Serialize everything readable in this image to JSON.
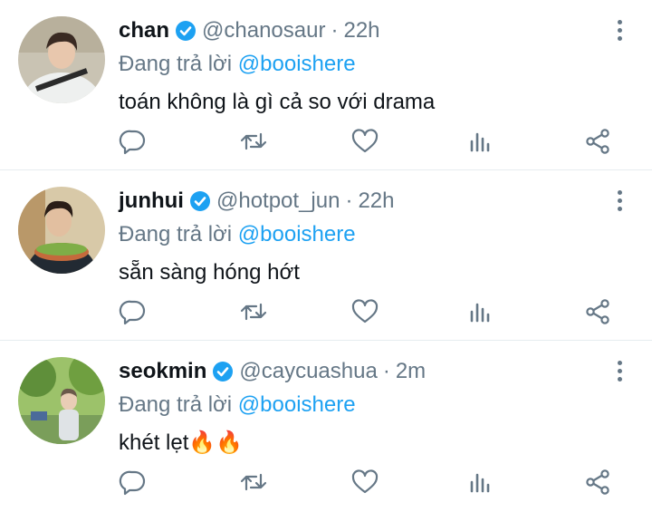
{
  "tweets": [
    {
      "name": "chan",
      "handle": "@chanosaur",
      "separator": "·",
      "time": "22h",
      "reply_prefix": "Đang trả lời",
      "reply_to": "@booishere",
      "text": "toán không là gì cả so với drama",
      "avatar_icon": "avatar-person-white-hoodie"
    },
    {
      "name": "junhui",
      "handle": "@hotpot_jun",
      "separator": "·",
      "time": "22h",
      "reply_prefix": "Đang trả lời",
      "reply_to": "@booishere",
      "text": "sẵn sàng hóng hớt",
      "avatar_icon": "avatar-person-holding-food"
    },
    {
      "name": "seokmin",
      "handle": "@caycuashua",
      "separator": "·",
      "time": "2m",
      "reply_prefix": "Đang trả lời",
      "reply_to": "@booishere",
      "text": "khét lẹt🔥🔥",
      "avatar_icon": "avatar-person-park"
    }
  ],
  "icons": {
    "reply": "reply-icon",
    "retweet": "retweet-icon",
    "like": "like-icon",
    "analytics": "analytics-icon",
    "share": "share-icon",
    "more": "more-options-icon",
    "verified": "verified-badge-icon"
  },
  "colors": {
    "name": "#0f1419",
    "muted": "#657786",
    "mention": "#1da1f2",
    "verified": "#1da1f2",
    "divider": "#e6ecf0"
  }
}
